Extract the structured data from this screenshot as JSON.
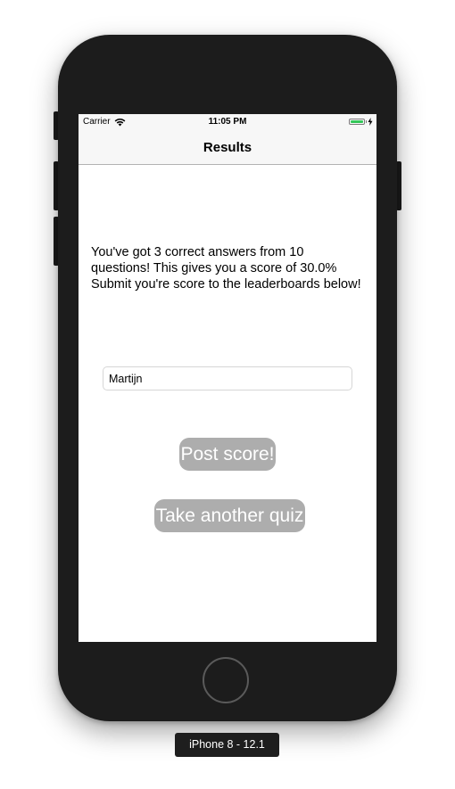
{
  "status_bar": {
    "carrier": "Carrier",
    "time": "11:05 PM",
    "battery_level": 1.0,
    "battery_color": "#34c759",
    "wifi_icon": "wifi-icon",
    "charging_icon": "bolt-icon"
  },
  "nav": {
    "title": "Results"
  },
  "result": {
    "message": "You've got 3 correct answers from 10 questions! This gives you a score of 30.0% Submit you're score to the leaderboards below!"
  },
  "name_field": {
    "value": "Martijn",
    "placeholder": ""
  },
  "buttons": {
    "post_score": "Post score!",
    "take_another_quiz": "Take another quiz"
  },
  "device": {
    "label": "iPhone 8 - 12.1"
  },
  "colors": {
    "button_background": "#adadad",
    "button_text": "#ffffff",
    "device_body": "#1c1c1c"
  }
}
